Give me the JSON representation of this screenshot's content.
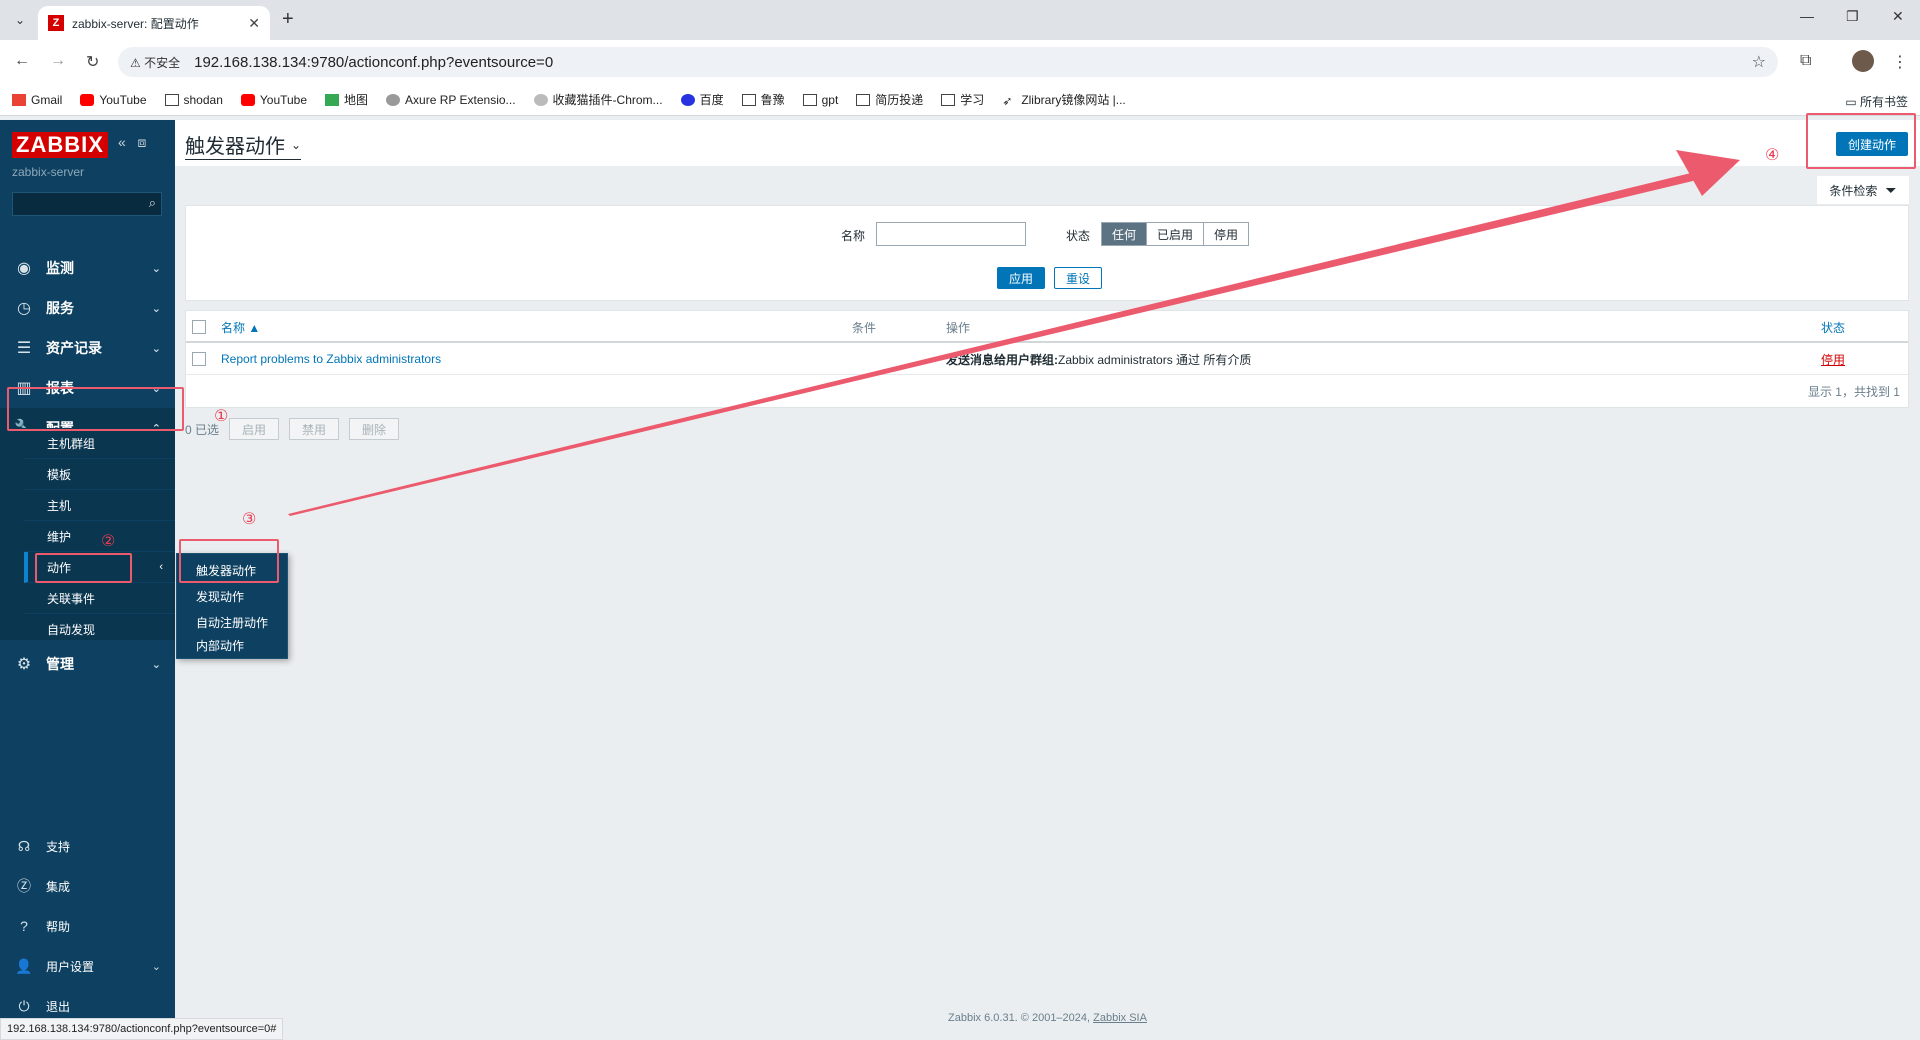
{
  "browser": {
    "tab_title": "zabbix-server: 配置动作",
    "favicon": "Z",
    "insecure_label": "不安全",
    "url": "192.168.138.134:9780/actionconf.php?eventsource=0",
    "bookmarks": [
      "Gmail",
      "YouTube",
      "shodan",
      "YouTube",
      "地图",
      "Axure RP Extensio...",
      "收藏猫插件-Chrom...",
      "百度",
      "鲁豫",
      "gpt",
      "简历投递",
      "学习",
      "Zlibrary镜像网站 |..."
    ],
    "all_bookmarks": "所有书签",
    "status_url": "192.168.138.134:9780/actionconf.php?eventsource=0#"
  },
  "sidebar": {
    "logo": "ZABBIX",
    "server": "zabbix-server",
    "menu": [
      {
        "label": "监测",
        "icon": "eye-icon"
      },
      {
        "label": "服务",
        "icon": "clock-icon"
      },
      {
        "label": "资产记录",
        "icon": "list-icon"
      },
      {
        "label": "报表",
        "icon": "chart-icon"
      },
      {
        "label": "配置",
        "icon": "wrench-icon"
      }
    ],
    "submenu": [
      "主机群组",
      "模板",
      "主机",
      "维护",
      "动作",
      "关联事件",
      "自动发现"
    ],
    "admin": "管理",
    "bottom": [
      "支持",
      "集成",
      "帮助",
      "用户设置",
      "退出"
    ],
    "flyout": [
      "触发器动作",
      "发现动作",
      "自动注册动作",
      "内部动作"
    ]
  },
  "header": {
    "title": "触发器动作",
    "create_button": "创建动作"
  },
  "filter": {
    "tab_label": "条件检索",
    "name_label": "名称",
    "status_label": "状态",
    "status_options": [
      "任何",
      "已启用",
      "停用"
    ],
    "apply": "应用",
    "reset": "重设"
  },
  "table": {
    "columns": [
      "名称 ▲",
      "条件",
      "操作",
      "状态"
    ],
    "rows": [
      {
        "name": "Report problems to Zabbix administrators",
        "condition": "",
        "operation_bold": "发送消息给用户群组:",
        "operation_rest": " Zabbix administrators 通过 所有介质",
        "status": "停用"
      }
    ],
    "footer": "显示 1，共找到 1"
  },
  "mass_actions": {
    "selected": "0 已选",
    "buttons": [
      "启用",
      "禁用",
      "删除"
    ]
  },
  "footer": {
    "text": "Zabbix 6.0.31. © 2001–2024, ",
    "link": "Zabbix SIA"
  },
  "annotations": [
    "①",
    "②",
    "③",
    "④"
  ],
  "colors": {
    "sidebar": "#0e4161",
    "accent": "#0275b8",
    "annotation": "#ec5a6d",
    "brand": "#d40000"
  }
}
